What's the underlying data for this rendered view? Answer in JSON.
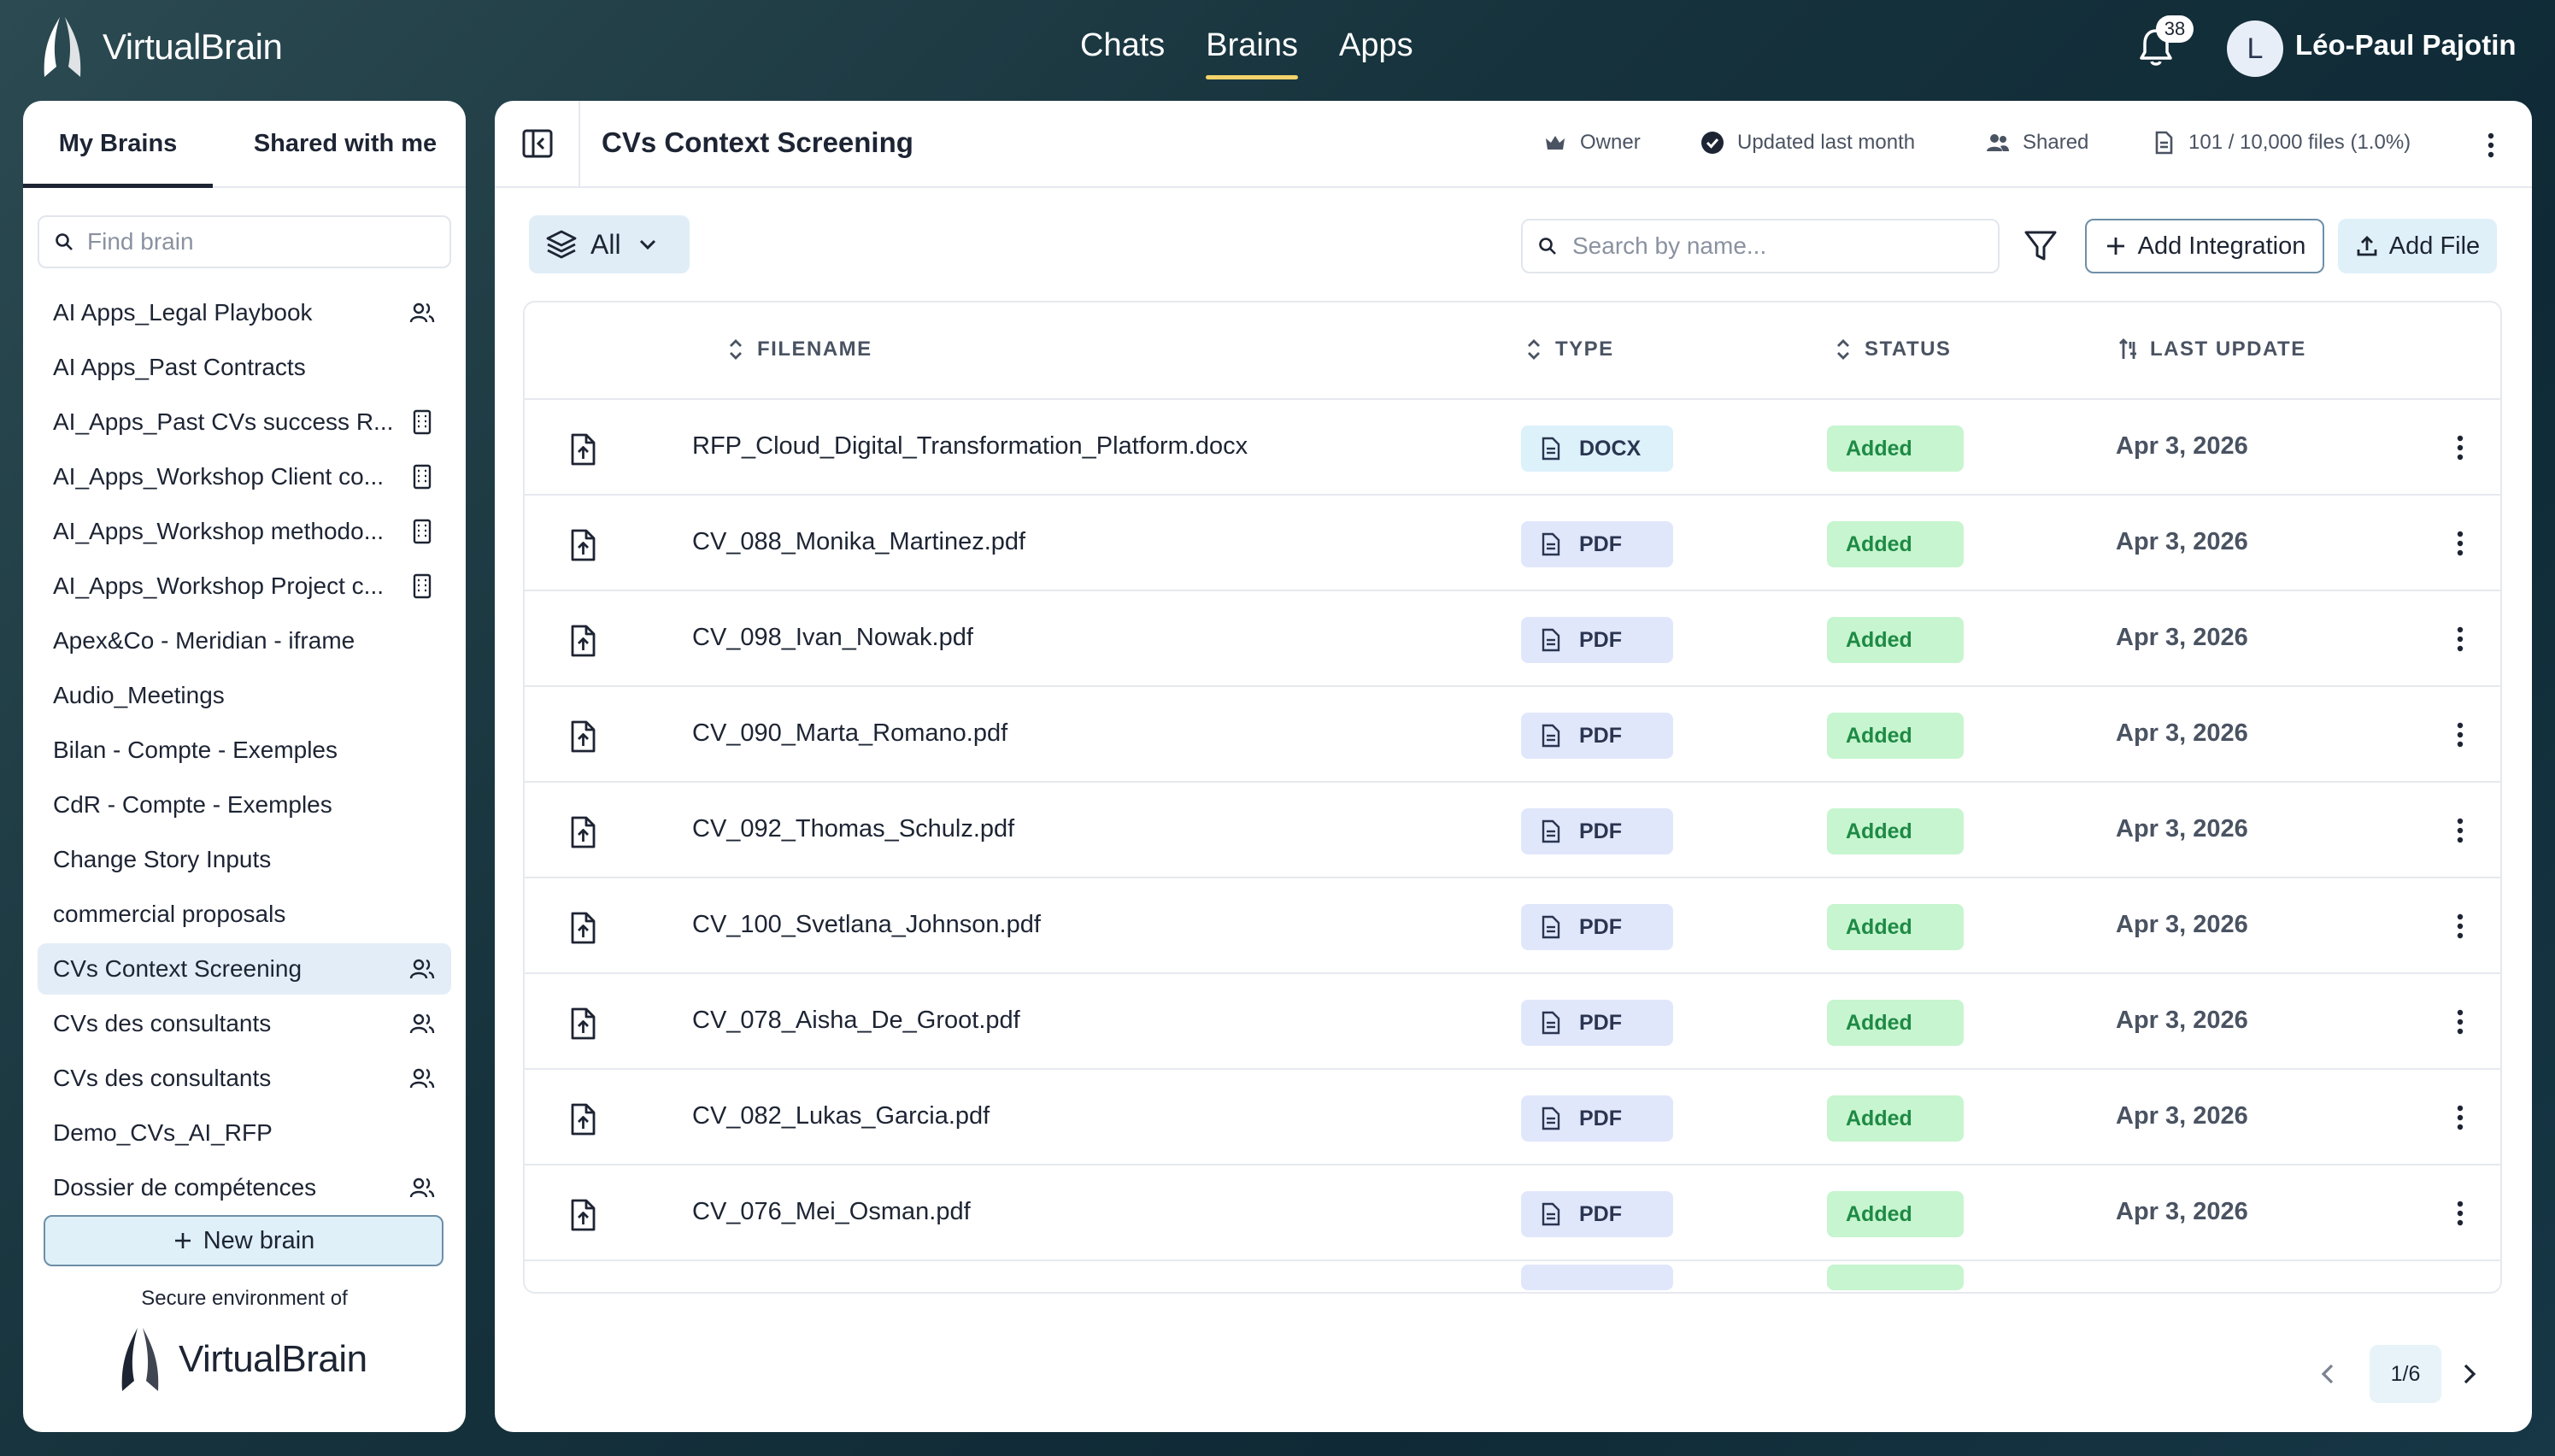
{
  "header": {
    "logo_text": "VirtualBrain",
    "nav": [
      {
        "label": "Chats",
        "active": false
      },
      {
        "label": "Brains",
        "active": true
      },
      {
        "label": "Apps",
        "active": false
      }
    ],
    "notifications_count": "38",
    "avatar_initial": "L",
    "user_name": "Léo-Paul Pajotin",
    "accent_color": "#f3d36a"
  },
  "sidebar": {
    "tabs": [
      "My Brains",
      "Shared with me"
    ],
    "active_tab": "My Brains",
    "search_placeholder": "Find brain",
    "items": [
      {
        "label": "AI Apps_Legal Playbook",
        "icon": "users-icon"
      },
      {
        "label": "AI Apps_Past Contracts",
        "icon": ""
      },
      {
        "label": "AI_Apps_Past CVs success R...",
        "icon": "building-icon"
      },
      {
        "label": "AI_Apps_Workshop Client co...",
        "icon": "building-icon"
      },
      {
        "label": "AI_Apps_Workshop methodo...",
        "icon": "building-icon"
      },
      {
        "label": "AI_Apps_Workshop Project c...",
        "icon": "building-icon"
      },
      {
        "label": "Apex&Co - Meridian - iframe",
        "icon": ""
      },
      {
        "label": "Audio_Meetings",
        "icon": ""
      },
      {
        "label": "Bilan - Compte - Exemples",
        "icon": ""
      },
      {
        "label": "CdR - Compte - Exemples",
        "icon": ""
      },
      {
        "label": "Change Story Inputs",
        "icon": ""
      },
      {
        "label": "commercial proposals",
        "icon": ""
      },
      {
        "label": "CVs Context Screening",
        "icon": "users-icon",
        "active": true
      },
      {
        "label": "CVs des consultants",
        "icon": "users-icon"
      },
      {
        "label": "CVs des consultants",
        "icon": "users-icon"
      },
      {
        "label": "Demo_CVs_AI_RFP",
        "icon": ""
      },
      {
        "label": "Dossier de compétences",
        "icon": "users-icon"
      }
    ],
    "new_brain_label": "New brain",
    "secure_text": "Secure environment of",
    "secure_logo_text": "VirtualBrain"
  },
  "main": {
    "title": "CVs Context Screening",
    "meta": {
      "owner": "Owner",
      "updated": "Updated last month",
      "shared": "Shared",
      "files": "101 / 10,000 files (1.0%)"
    },
    "filter_label": "All",
    "search_placeholder": "Search by name...",
    "add_integration_label": "Add Integration",
    "add_file_label": "Add File",
    "columns": [
      "FILENAME",
      "TYPE",
      "STATUS",
      "LAST UPDATE"
    ],
    "rows": [
      {
        "filename": "RFP_Cloud_Digital_Transformation_Platform.docx",
        "type": "DOCX",
        "status": "Added",
        "date": "Apr 3, 2026"
      },
      {
        "filename": "CV_088_Monika_Martinez.pdf",
        "type": "PDF",
        "status": "Added",
        "date": "Apr 3, 2026"
      },
      {
        "filename": "CV_098_Ivan_Nowak.pdf",
        "type": "PDF",
        "status": "Added",
        "date": "Apr 3, 2026"
      },
      {
        "filename": "CV_090_Marta_Romano.pdf",
        "type": "PDF",
        "status": "Added",
        "date": "Apr 3, 2026"
      },
      {
        "filename": "CV_092_Thomas_Schulz.pdf",
        "type": "PDF",
        "status": "Added",
        "date": "Apr 3, 2026"
      },
      {
        "filename": "CV_100_Svetlana_Johnson.pdf",
        "type": "PDF",
        "status": "Added",
        "date": "Apr 3, 2026"
      },
      {
        "filename": "CV_078_Aisha_De_Groot.pdf",
        "type": "PDF",
        "status": "Added",
        "date": "Apr 3, 2026"
      },
      {
        "filename": "CV_082_Lukas_Garcia.pdf",
        "type": "PDF",
        "status": "Added",
        "date": "Apr 3, 2026"
      },
      {
        "filename": "CV_076_Mei_Osman.pdf",
        "type": "PDF",
        "status": "Added",
        "date": "Apr 3, 2026"
      }
    ],
    "pagination": "1/6",
    "colors": {
      "status_added_bg": "#c7f5cf",
      "status_added_text": "#1e8a45",
      "pdf_badge_bg": "#e1e7fb",
      "docx_badge_bg": "#dcf1fa"
    }
  }
}
